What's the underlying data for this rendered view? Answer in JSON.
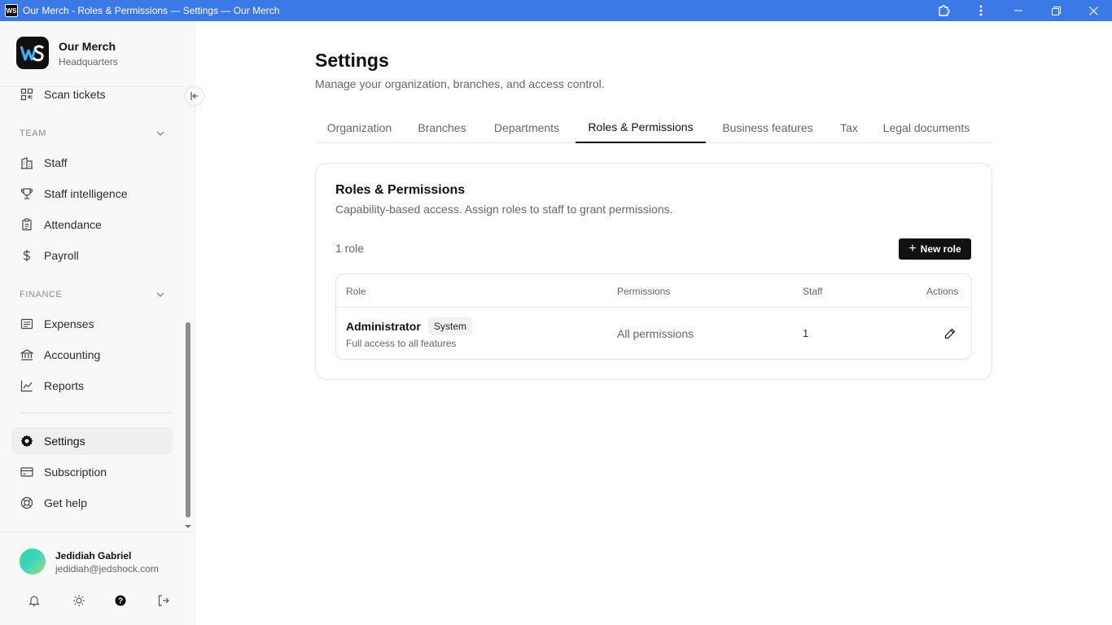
{
  "window": {
    "title": "Our Merch - Roles & Permissions — Settings — Our Merch",
    "app_icon_text": "WS"
  },
  "sidebar": {
    "org": {
      "name": "Our Merch",
      "subtitle": "Headquarters"
    },
    "top_item": {
      "label": "Scan tickets",
      "icon": "qr-scan-icon"
    },
    "team": {
      "header": "TEAM",
      "items": [
        {
          "label": "Staff",
          "icon": "building-icon"
        },
        {
          "label": "Staff intelligence",
          "icon": "trophy-icon"
        },
        {
          "label": "Attendance",
          "icon": "clipboard-icon"
        },
        {
          "label": "Payroll",
          "icon": "dollar-icon"
        }
      ]
    },
    "finance": {
      "header": "FINANCE",
      "items": [
        {
          "label": "Expenses",
          "icon": "receipt-icon"
        },
        {
          "label": "Accounting",
          "icon": "bank-icon"
        },
        {
          "label": "Reports",
          "icon": "chart-line-icon"
        }
      ]
    },
    "bottom_items": [
      {
        "label": "Settings",
        "icon": "gear-icon",
        "active": true
      },
      {
        "label": "Subscription",
        "icon": "credit-card-icon"
      },
      {
        "label": "Get help",
        "icon": "lifebuoy-icon"
      }
    ],
    "user": {
      "name": "Jedidiah Gabriel",
      "email": "jedidiah@jedshock.com"
    }
  },
  "main": {
    "title": "Settings",
    "subtitle": "Manage your organization, branches, and access control.",
    "tabs": [
      {
        "label": "Organization"
      },
      {
        "label": "Branches"
      },
      {
        "label": "Departments"
      },
      {
        "label": "Roles & Permissions",
        "active": true
      },
      {
        "label": "Business features"
      },
      {
        "label": "Tax"
      },
      {
        "label": "Legal documents"
      }
    ],
    "card": {
      "title": "Roles & Permissions",
      "subtitle": "Capability-based access. Assign roles to staff to grant permissions.",
      "count": "1 role",
      "new_role_label": "New role",
      "table": {
        "headers": {
          "role": "Role",
          "permissions": "Permissions",
          "staff": "Staff",
          "actions": "Actions"
        },
        "rows": [
          {
            "name": "Administrator",
            "badge": "System",
            "description": "Full access to all features",
            "permissions": "All permissions",
            "staff": "1"
          }
        ]
      }
    }
  },
  "colors": {
    "titlebar": "#3b7ae6",
    "primary_button": "#111111",
    "sidebar_bg": "#f8f8f8"
  }
}
